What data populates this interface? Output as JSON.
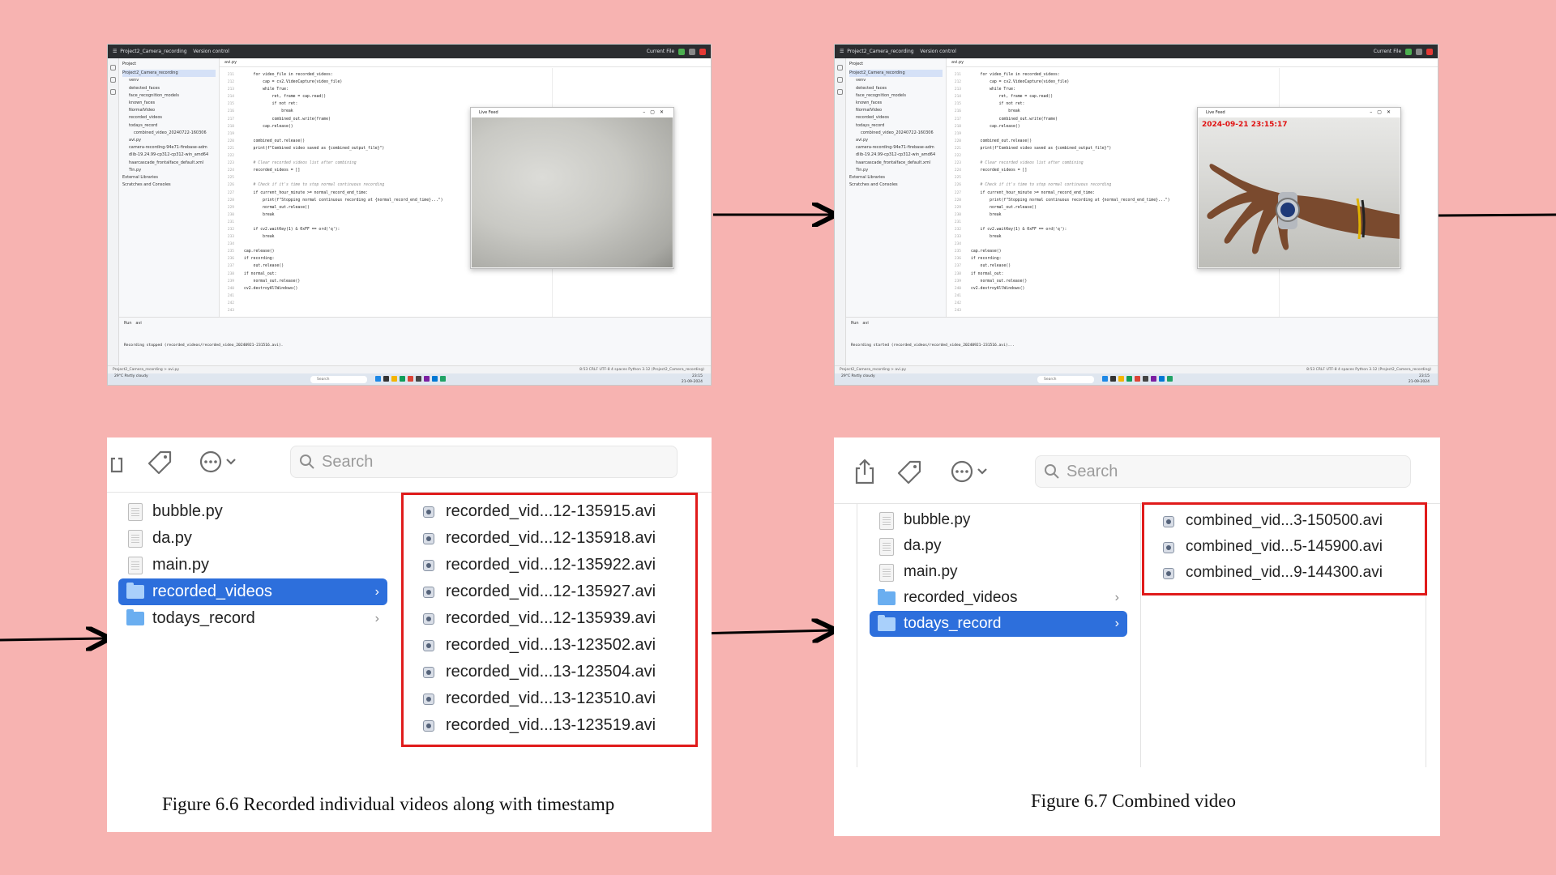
{
  "ide": {
    "project_name": "Project2_Camera_recording",
    "version_control": "Version control",
    "current_file": "Current File",
    "project_label": "Project",
    "tab_file": "avi.py",
    "tree": [
      "Project2_Camera_recording",
      "venv",
      "detected_faces",
      "face_recognition_models",
      "known_faces",
      "NormalVideo",
      "recorded_videos",
      "todays_record",
      "combined_video_20240722-160306",
      "avi.py",
      "camera-recording-94e71-firebase-adm",
      "dlib-19.24.99-cp312-cp312-win_amd64",
      "haarcascade_frontalface_default.xml",
      "Tin.py",
      "External Libraries",
      "Scratches and Consoles"
    ],
    "line_numbers": [
      "211",
      "212",
      "213",
      "214",
      "215",
      "216",
      "217",
      "218",
      "219",
      "220",
      "221",
      "222",
      "223",
      "224",
      "225",
      "226",
      "227",
      "228",
      "229",
      "230",
      "231",
      "232",
      "233",
      "234",
      "235",
      "236",
      "237",
      "238",
      "239",
      "240",
      "241",
      "242",
      "243"
    ],
    "code_lines": [
      "    for video_file in recorded_videos:",
      "        cap = cv2.VideoCapture(video_file)",
      "        while True:",
      "            ret, frame = cap.read()",
      "            if not ret:",
      "                break",
      "            combined_out.write(frame)",
      "        cap.release()",
      "",
      "    combined_out.release()",
      "    print(f\"Combined video saved as {combined_output_file}\")",
      "",
      "    # Clear recorded videos list after combining",
      "    recorded_videos = []",
      "",
      "    # Check if it's time to stop normal continuous recording",
      "    if current_hour_minute >= normal_record_end_time:",
      "        print(f\"Stopping normal continuous recording at {normal_record_end_time}...\")",
      "        normal_out.release()",
      "        break",
      "",
      "    if cv2.waitKey(1) & 0xFF == ord('q'):",
      "        break",
      "",
      "cap.release()",
      "if recording:",
      "    out.release()",
      "if normal_out:",
      "    normal_out.release()",
      "cv2.destroyAllWindows()",
      ""
    ],
    "run_label": "Run",
    "run_tab": "avi",
    "output_1": "Recording stopped (recorded_videos/recorded_video_20240921-231516.avi).",
    "output_2": "Recording started (recorded_videos/recorded_video_20240921-231516.avi)...",
    "status_path_1": "Project2_Camera_recording > avi.py",
    "status_right": "8:53  CRLF  UTF-8  4 spaces  Python 3.12 (Project2_Camera_recording)",
    "live_feed_title": "Live Feed",
    "timestamp_overlay": "2024-09-21 23:15:17",
    "weather": "29°C Partly cloudy",
    "search": "Search",
    "clock_time": "23:15",
    "clock_date": "21-09-2024"
  },
  "finder_left": {
    "search_placeholder": "Search",
    "sidebar": [
      {
        "label": "bubble.py",
        "type": "file"
      },
      {
        "label": "da.py",
        "type": "file"
      },
      {
        "label": "main.py",
        "type": "file"
      },
      {
        "label": "recorded_videos",
        "type": "folder",
        "selected": true
      },
      {
        "label": "todays_record",
        "type": "folder",
        "selected": false
      }
    ],
    "files": [
      "recorded_vid...12-135915.avi",
      "recorded_vid...12-135918.avi",
      "recorded_vid...12-135922.avi",
      "recorded_vid...12-135927.avi",
      "recorded_vid...12-135939.avi",
      "recorded_vid...13-123502.avi",
      "recorded_vid...13-123504.avi",
      "recorded_vid...13-123510.avi",
      "recorded_vid...13-123519.avi"
    ],
    "caption": "Figure 6.6 Recorded individual videos along with timestamp"
  },
  "finder_right": {
    "search_placeholder": "Search",
    "sidebar": [
      {
        "label": "bubble.py",
        "type": "file"
      },
      {
        "label": "da.py",
        "type": "file"
      },
      {
        "label": "main.py",
        "type": "file"
      },
      {
        "label": "recorded_videos",
        "type": "folder",
        "selected": false
      },
      {
        "label": "todays_record",
        "type": "folder",
        "selected": true
      }
    ],
    "files": [
      "combined_vid...3-150500.avi",
      "combined_vid...5-145900.avi",
      "combined_vid...9-144300.avi"
    ],
    "caption": "Figure 6.7 Combined video"
  },
  "colors": {
    "background": "#f7b3b1",
    "highlight_box": "#e01b1b",
    "selection": "#2d6fdc",
    "timestamp": "#e01010"
  }
}
